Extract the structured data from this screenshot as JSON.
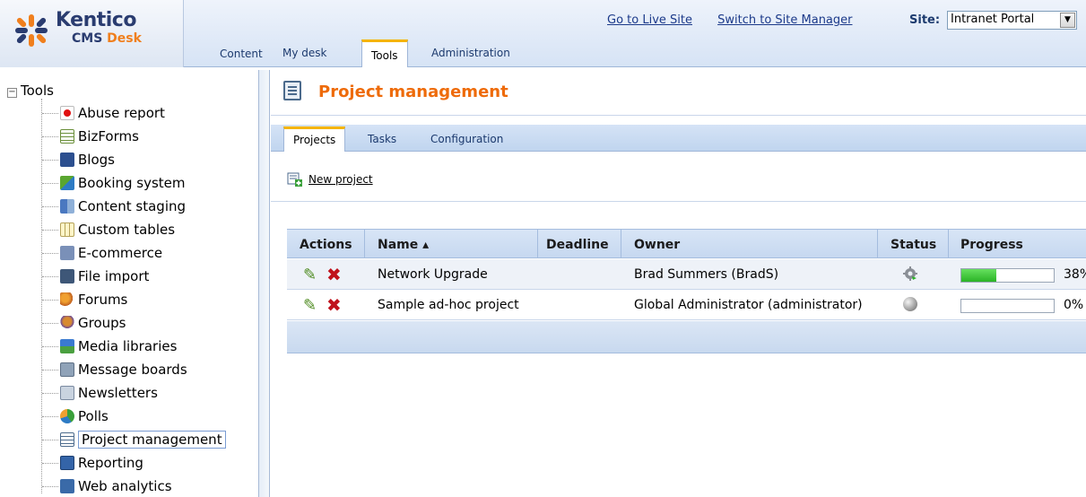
{
  "header": {
    "logo_title": "Kentico",
    "logo_sub_cms": "CMS",
    "logo_sub_desk": "Desk",
    "content_tab": "Content",
    "links": {
      "live_site": "Go to Live Site",
      "site_manager": "Switch to Site Manager"
    },
    "site_label": "Site:",
    "site_value": "Intranet Portal",
    "tabs": [
      "My desk",
      "Tools",
      "Administration"
    ],
    "active_tab": "Tools"
  },
  "tree": {
    "root": "Tools",
    "items": [
      {
        "label": "Abuse report",
        "icon": "abuse-report-icon"
      },
      {
        "label": "BizForms",
        "icon": "bizforms-icon"
      },
      {
        "label": "Blogs",
        "icon": "blogs-icon"
      },
      {
        "label": "Booking system",
        "icon": "booking-system-icon"
      },
      {
        "label": "Content staging",
        "icon": "content-staging-icon"
      },
      {
        "label": "Custom tables",
        "icon": "custom-tables-icon"
      },
      {
        "label": "E-commerce",
        "icon": "ecommerce-icon"
      },
      {
        "label": "File import",
        "icon": "file-import-icon"
      },
      {
        "label": "Forums",
        "icon": "forums-icon"
      },
      {
        "label": "Groups",
        "icon": "groups-icon"
      },
      {
        "label": "Media libraries",
        "icon": "media-libraries-icon"
      },
      {
        "label": "Message boards",
        "icon": "message-boards-icon"
      },
      {
        "label": "Newsletters",
        "icon": "newsletters-icon"
      },
      {
        "label": "Polls",
        "icon": "polls-icon"
      },
      {
        "label": "Project management",
        "icon": "project-management-icon"
      },
      {
        "label": "Reporting",
        "icon": "reporting-icon"
      },
      {
        "label": "Web analytics",
        "icon": "web-analytics-icon"
      }
    ],
    "selected": "Project management"
  },
  "main": {
    "title": "Project management",
    "tabs": [
      "Projects",
      "Tasks",
      "Configuration"
    ],
    "active_tab": "Projects",
    "new_project": "New project",
    "grid": {
      "columns": [
        "Actions",
        "Name ▴",
        "Deadline",
        "Owner",
        "Status",
        "Progress"
      ],
      "rows": [
        {
          "name": "Network Upgrade",
          "deadline": "",
          "owner": "Brad Summers (BradS)",
          "status_icon": "gear-status-icon",
          "progress": 38,
          "progress_text": "38%"
        },
        {
          "name": "Sample ad-hoc project",
          "deadline": "",
          "owner": "Global Administrator (administrator)",
          "status_icon": "not-started-status-icon",
          "progress": 0,
          "progress_text": "0%"
        }
      ]
    }
  },
  "colors": {
    "title_orange": "#ee6b0a",
    "tab_accent": "#f5b400",
    "progress_green": "#2ab326",
    "delete_red": "#c0121c",
    "edit_green": "#4d8a1f"
  }
}
